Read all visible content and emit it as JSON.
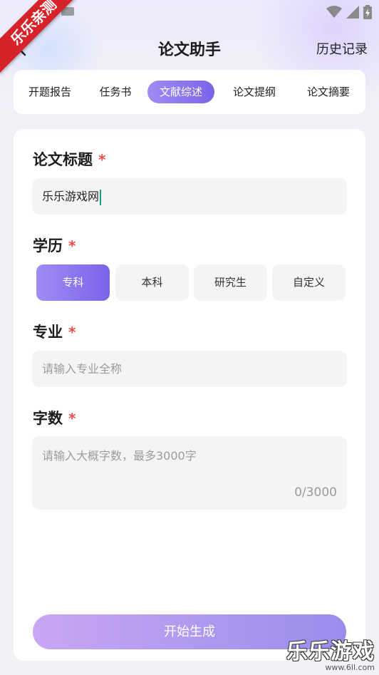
{
  "watermark": {
    "ribbon_text": "乐乐亲测",
    "logo_text": "乐乐游戏",
    "url_text": "www.6ll.com"
  },
  "header": {
    "title": "论文助手",
    "history_label": "历史记录"
  },
  "tabs": [
    {
      "label": "开题报告",
      "active": false
    },
    {
      "label": "任务书",
      "active": false
    },
    {
      "label": "文献综述",
      "active": true
    },
    {
      "label": "论文提纲",
      "active": false
    },
    {
      "label": "论文摘要",
      "active": false
    }
  ],
  "form": {
    "required_mark": "*",
    "title_label": "论文标题",
    "title_value": "乐乐游戏网",
    "education_label": "学历",
    "education_options": [
      {
        "label": "专科",
        "selected": true
      },
      {
        "label": "本科",
        "selected": false
      },
      {
        "label": "研究生",
        "selected": false
      },
      {
        "label": "自定义",
        "selected": false
      }
    ],
    "major_label": "专业",
    "major_placeholder": "请输入专业全称",
    "words_label": "字数",
    "words_placeholder": "请输入大概字数，最多3000字",
    "words_counter": "0/3000",
    "submit_label": "开始生成"
  },
  "colors": {
    "accent": "#7b63e8",
    "accent_light": "#a08cf5",
    "required": "#ef4b4b",
    "ribbon": "#d7222a"
  }
}
